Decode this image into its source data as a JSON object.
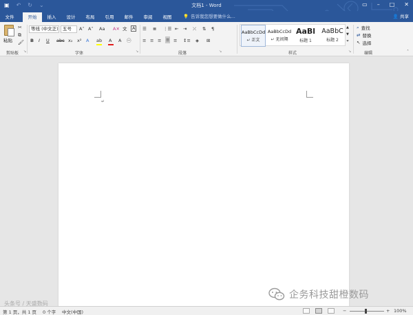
{
  "titlebar": {
    "title": "文档1 - Word",
    "qat": {
      "save_icon": "save-icon",
      "undo_icon": "undo-icon",
      "redo_icon": "redo-icon",
      "customize_icon": "customize-qat-icon"
    },
    "window_buttons": [
      "minimize-icon",
      "maximize-icon",
      "close-icon"
    ]
  },
  "tabs": [
    {
      "label": "文件",
      "active": false
    },
    {
      "label": "开始",
      "active": true
    },
    {
      "label": "插入",
      "active": false
    },
    {
      "label": "设计",
      "active": false
    },
    {
      "label": "布局",
      "active": false
    },
    {
      "label": "引用",
      "active": false
    },
    {
      "label": "邮件",
      "active": false
    },
    {
      "label": "审阅",
      "active": false
    },
    {
      "label": "视图",
      "active": false
    }
  ],
  "tell_me": {
    "placeholder": "告诉我您想要做什么...",
    "icon": "lightbulb-icon"
  },
  "share": {
    "label": "共享",
    "icon": "person-icon"
  },
  "ribbon": {
    "clipboard": {
      "group": "剪贴板",
      "paste": "粘贴"
    },
    "font": {
      "group": "字体",
      "font_name": "等线 (中文正)",
      "font_size": "五号",
      "bold": "B",
      "italic": "I",
      "underline": "U",
      "strike": "abc",
      "subscript": "x₂",
      "superscript": "x²",
      "grow": "A˄",
      "shrink": "A˅",
      "case": "Aa",
      "font_color": "A",
      "highlight": "ab"
    },
    "paragraph": {
      "group": "段落"
    },
    "styles": {
      "group": "样式",
      "items": [
        {
          "preview": "AaBbCcDd",
          "name": "↵ 正文",
          "selected": true
        },
        {
          "preview": "AaBbCcDd",
          "name": "↵ 无间隔",
          "selected": false
        },
        {
          "preview": "AaBl",
          "name": "标题 1",
          "selected": false
        },
        {
          "preview": "AaBbC",
          "name": "标题 2",
          "selected": false
        }
      ]
    },
    "editing": {
      "group": "编辑",
      "find": "查找",
      "replace": "替换",
      "select": "选择"
    }
  },
  "document": {
    "paragraph_mark": "↵"
  },
  "statusbar": {
    "page": "第 1 页，共 1 页",
    "words": "0 个字",
    "language": "中文(中国)",
    "zoom": "100%",
    "zoom_minus": "−",
    "zoom_plus": "+"
  },
  "watermarks": {
    "left": "头条号 / 天盛数码",
    "right": "企务科技甜橙数码"
  },
  "colors": {
    "brand": "#2b579a",
    "font_color_bar": "#e21c1c",
    "highlight_bar": "#ffff00"
  }
}
